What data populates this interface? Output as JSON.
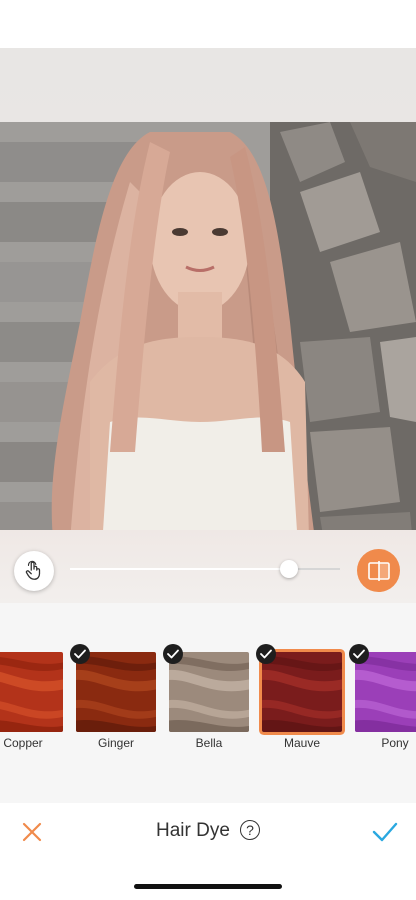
{
  "editor": {
    "intensity_value": "81",
    "intensity_level": 81
  },
  "swatches": [
    {
      "label": "Copper",
      "checked": false,
      "selected": false,
      "colors": [
        "#b3331a",
        "#d9542b",
        "#8a1f0c"
      ]
    },
    {
      "label": "Ginger",
      "checked": true,
      "selected": false,
      "colors": [
        "#8a2a10",
        "#b2481f",
        "#5c190a"
      ]
    },
    {
      "label": "Bella",
      "checked": true,
      "selected": false,
      "colors": [
        "#9c8a7c",
        "#c9b8a9",
        "#6e5c50"
      ]
    },
    {
      "label": "Mauve",
      "checked": true,
      "selected": true,
      "colors": [
        "#7a1c1c",
        "#a8302a",
        "#5a1212"
      ]
    },
    {
      "label": "Pony",
      "checked": true,
      "selected": false,
      "colors": [
        "#9b3fb8",
        "#c06ad9",
        "#7a2a96"
      ]
    }
  ],
  "bottom_bar": {
    "title": "Hair Dye",
    "help_symbol": "?"
  },
  "colors": {
    "accent": "#f08a4b",
    "check_confirm": "#2aa8e0",
    "close_x": "#f08a4b"
  },
  "icons": {
    "gesture": "hand-pointer-icon",
    "compare": "compare-split-icon",
    "close": "close-icon",
    "confirm": "checkmark-icon",
    "help": "help-circle-icon"
  }
}
